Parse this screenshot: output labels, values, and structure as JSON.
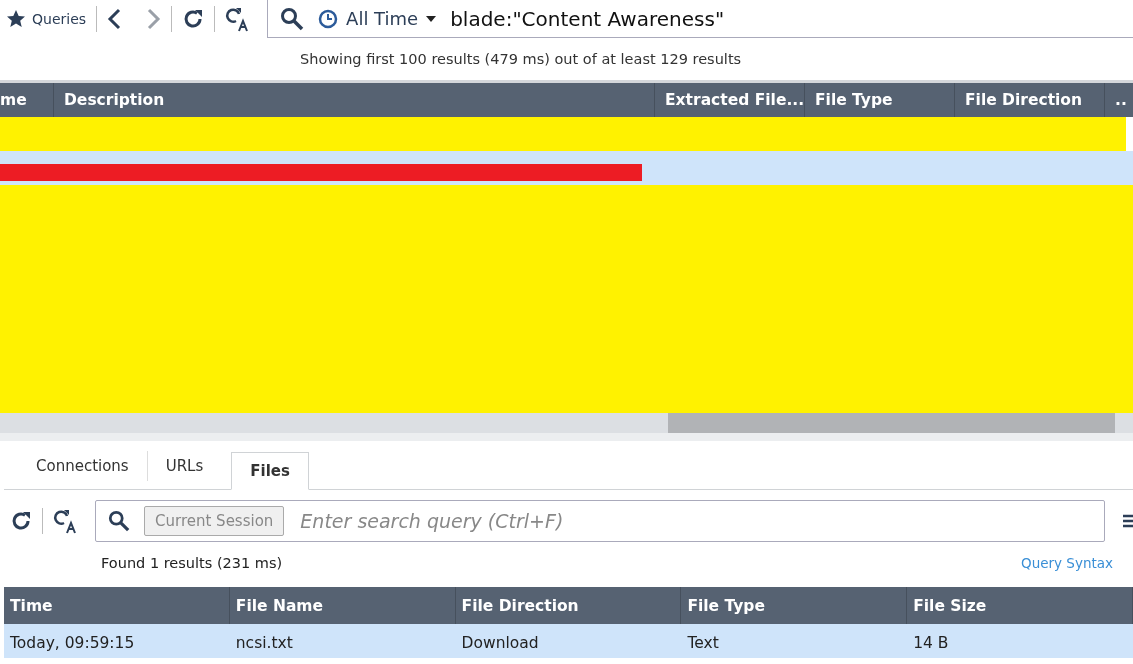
{
  "toolbar": {
    "queries_label": "Queries",
    "time_range": "All Time",
    "query": "blade:\"Content Awareness\""
  },
  "status": "Showing first 100 results (479 ms) out of at least 129 results",
  "results_table": {
    "columns": [
      "me",
      "Description",
      "Extracted File...",
      "File Type",
      "File Direction",
      ".."
    ],
    "rows": [
      {
        "selected": false,
        "redaction": {
          "kind": "full",
          "color": "#fff200"
        }
      },
      {
        "selected": true,
        "redaction": {
          "kind": "partial",
          "color": "#ed1c24"
        }
      }
    ],
    "redacted_area": {
      "color": "#fff200"
    }
  },
  "tabs": [
    {
      "label": "Connections",
      "selected": false
    },
    {
      "label": "URLs",
      "selected": false
    },
    {
      "label": "Files",
      "selected": true
    }
  ],
  "details": {
    "scope": "Current Session",
    "search": {
      "placeholder": "Enter search query (Ctrl+F)"
    },
    "found": "Found 1 results (231 ms)",
    "syntax_link": "Query Syntax",
    "columns": [
      "Time",
      "File Name",
      "File Direction",
      "File Type",
      "File Size"
    ],
    "rows": [
      {
        "selected": true,
        "cells": [
          "Today, 09:59:15",
          "ncsi.txt",
          "Download",
          "Text",
          "14 B"
        ]
      }
    ]
  }
}
